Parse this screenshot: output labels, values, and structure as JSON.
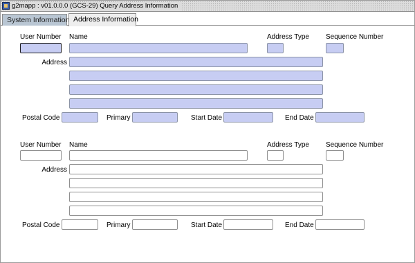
{
  "window": {
    "title": "g2mapp : v01.0.0.0 (GCS-29) Query Address Information"
  },
  "tabs": [
    {
      "label": "System Information",
      "active": false
    },
    {
      "label": "Address Information",
      "active": true
    }
  ],
  "labels": {
    "user_number": "User Number",
    "name": "Name",
    "address_type": "Address Type",
    "sequence_number": "Sequence Number",
    "address": "Address",
    "postal_code": "Postal Code",
    "primary": "Primary",
    "start_date": "Start Date",
    "end_date": "End Date"
  },
  "records": [
    {
      "user_number": "",
      "name": "",
      "address_type": "",
      "sequence_number": "",
      "address_lines": [
        "",
        "",
        "",
        ""
      ],
      "postal_code": "",
      "primary": "",
      "start_date": "",
      "end_date": ""
    },
    {
      "user_number": "",
      "name": "",
      "address_type": "",
      "sequence_number": "",
      "address_lines": [
        "",
        "",
        "",
        ""
      ],
      "postal_code": "",
      "primary": "",
      "start_date": "",
      "end_date": ""
    }
  ],
  "colors": {
    "field_fill": "#c7cdf3",
    "tab_inactive": "#b9c6d3",
    "tab_active": "#eeeeee"
  }
}
